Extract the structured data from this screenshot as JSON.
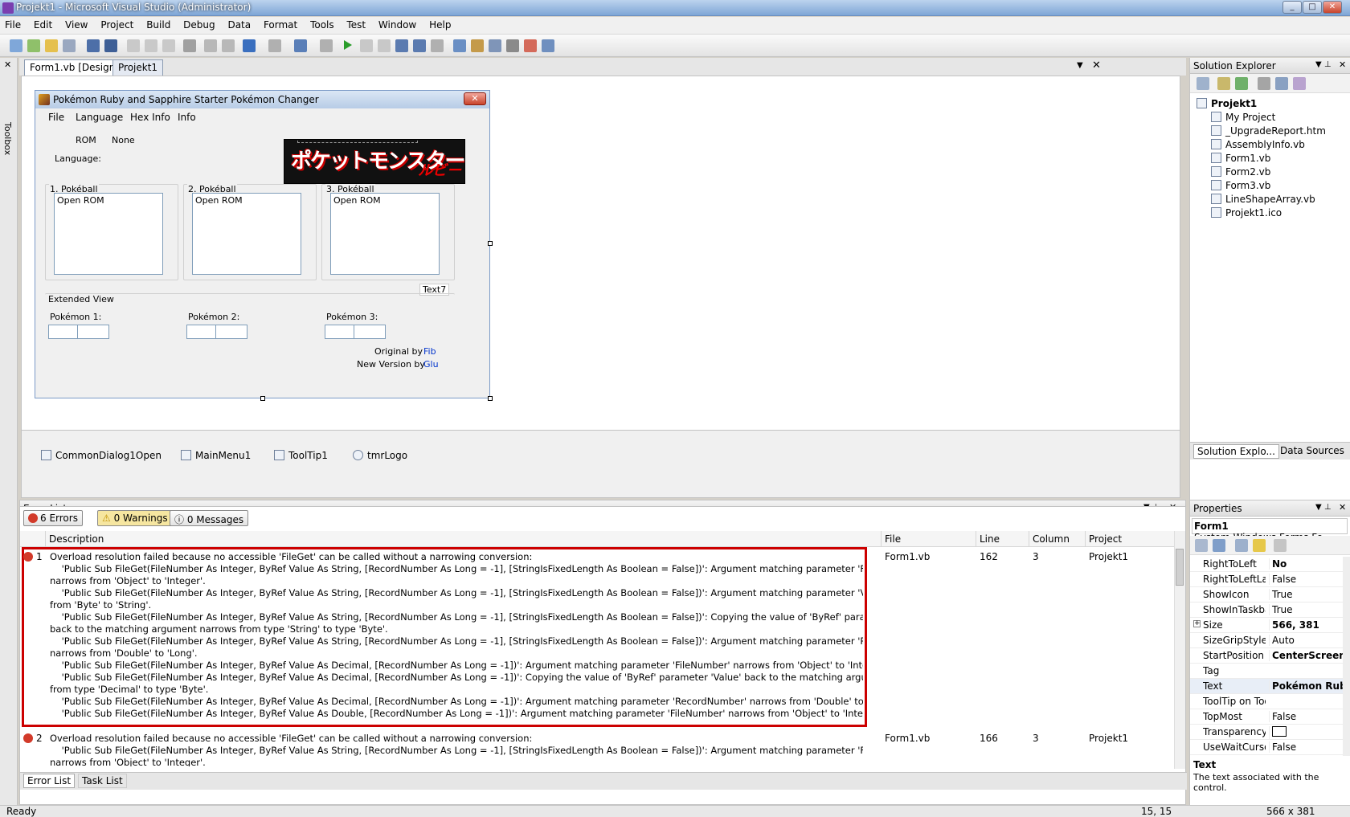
{
  "window": {
    "title": "Projekt1 - Microsoft Visual Studio (Administrator)"
  },
  "menu": [
    "File",
    "Edit",
    "View",
    "Project",
    "Build",
    "Debug",
    "Data",
    "Format",
    "Tools",
    "Test",
    "Window",
    "Help"
  ],
  "lefttool": {
    "label": "Toolbox"
  },
  "doctabs": {
    "active": "Form1.vb [Design]",
    "other": "Projekt1"
  },
  "form": {
    "title": "Pokémon Ruby and Sapphire Starter Pokémon Changer",
    "menu": {
      "file": "File",
      "language": "Language",
      "hexinfo": "Hex Info",
      "info": "Info"
    },
    "rom_label": "ROM",
    "rom_value": "None",
    "language_label": "Language:",
    "balls": [
      {
        "label": "1. Pokéball",
        "list": "Open ROM"
      },
      {
        "label": "2. Pokéball",
        "list": "Open ROM"
      },
      {
        "label": "3. Pokéball",
        "list": "Open ROM"
      }
    ],
    "text7": "Text7",
    "extended": "Extended View",
    "pokemon": [
      "Pokémon 1:",
      "Pokémon 2:",
      "Pokémon 3:"
    ],
    "original_by": "Original by",
    "original_name": "Fib",
    "new_version_by": "New Version by",
    "new_name": "Glu"
  },
  "tray": [
    "CommonDialog1Open",
    "MainMenu1",
    "ToolTip1",
    "tmrLogo"
  ],
  "solution_explorer": {
    "title": "Solution Explorer",
    "root": "Projekt1",
    "items": [
      "My Project",
      "_UpgradeReport.htm",
      "AssemblyInfo.vb",
      "Form1.vb",
      "Form2.vb",
      "Form3.vb",
      "LineShapeArray.vb",
      "Projekt1.ico"
    ],
    "tab1": "Solution Explo...",
    "tab2": "Data Sources"
  },
  "properties": {
    "title": "Properties",
    "object": "Form1",
    "object_type": "System.Windows.Forms.Fo",
    "rows": [
      {
        "k": "RightToLeft",
        "v": "No"
      },
      {
        "k": "RightToLeftLay",
        "v": "False"
      },
      {
        "k": "ShowIcon",
        "v": "True"
      },
      {
        "k": "ShowInTaskbar",
        "v": "True"
      },
      {
        "k": "Size",
        "v": "566, 381"
      },
      {
        "k": "SizeGripStyle",
        "v": "Auto"
      },
      {
        "k": "StartPosition",
        "v": "CenterScreen"
      },
      {
        "k": "Tag",
        "v": ""
      },
      {
        "k": "Text",
        "v": "Pokémon Ruby"
      },
      {
        "k": "ToolTip on Too",
        "v": ""
      },
      {
        "k": "TopMost",
        "v": "False"
      },
      {
        "k": "TransparencyK",
        "v": ""
      },
      {
        "k": "UseWaitCursor",
        "v": "False"
      }
    ],
    "desc_title": "Text",
    "desc_text": "The text associated with the control."
  },
  "errorlist": {
    "title": "Error List",
    "errors": "6 Errors",
    "warnings": "0 Warnings",
    "messages": "0 Messages",
    "columns": [
      "Description",
      "File",
      "Line",
      "Column",
      "Project"
    ],
    "rows": [
      {
        "num": "1",
        "desc": "Overload resolution failed because no accessible 'FileGet' can be called without a narrowing conversion:\n    'Public Sub FileGet(FileNumber As Integer, ByRef Value As String, [RecordNumber As Long = -1], [StringIsFixedLength As Boolean = False])': Argument matching parameter 'FileNumber'\nnarrows from 'Object' to 'Integer'.\n    'Public Sub FileGet(FileNumber As Integer, ByRef Value As String, [RecordNumber As Long = -1], [StringIsFixedLength As Boolean = False])': Argument matching parameter 'Value' narrows\nfrom 'Byte' to 'String'.\n    'Public Sub FileGet(FileNumber As Integer, ByRef Value As String, [RecordNumber As Long = -1], [StringIsFixedLength As Boolean = False])': Copying the value of 'ByRef' parameter 'Value'\nback to the matching argument narrows from type 'String' to type 'Byte'.\n    'Public Sub FileGet(FileNumber As Integer, ByRef Value As String, [RecordNumber As Long = -1], [StringIsFixedLength As Boolean = False])': Argument matching parameter 'RecordNumber'\nnarrows from 'Double' to 'Long'.\n    'Public Sub FileGet(FileNumber As Integer, ByRef Value As Decimal, [RecordNumber As Long = -1])': Argument matching parameter 'FileNumber' narrows from 'Object' to 'Integer'.\n    'Public Sub FileGet(FileNumber As Integer, ByRef Value As Decimal, [RecordNumber As Long = -1])': Copying the value of 'ByRef' parameter 'Value' back to the matching argument narrows\nfrom type 'Decimal' to type 'Byte'.\n    'Public Sub FileGet(FileNumber As Integer, ByRef Value As Decimal, [RecordNumber As Long = -1])': Argument matching parameter 'RecordNumber' narrows from 'Double' to 'Long'.\n    'Public Sub FileGet(FileNumber As Integer, ByRef Value As Double, [RecordNumber As Long = -1])': Argument matching parameter 'FileNumber' narrows from 'Object' to 'Integer'.\n    'Public Sub FileGet(FileNumber As Integer, ByRef Value As Double, [RecordNumber As Long = -1])': Copying the value of 'ByRef' parameter 'Value' back to the matching argument narrows ...",
        "file": "Form1.vb",
        "line": "162",
        "column": "3",
        "project": "Projekt1"
      },
      {
        "num": "2",
        "desc": "Overload resolution failed because no accessible 'FileGet' can be called without a narrowing conversion:\n    'Public Sub FileGet(FileNumber As Integer, ByRef Value As String, [RecordNumber As Long = -1], [StringIsFixedLength As Boolean = False])': Argument matching parameter 'FileNumber'\nnarrows from 'Object' to 'Integer'.",
        "file": "Form1.vb",
        "line": "166",
        "column": "3",
        "project": "Projekt1"
      }
    ],
    "tab1": "Error List",
    "tab2": "Task List"
  },
  "status": {
    "left": "Ready",
    "pos": "15, 15",
    "size": "566 x 381"
  },
  "colors": {
    "error_highlight": "#cc0000",
    "link": "#0033cc"
  }
}
